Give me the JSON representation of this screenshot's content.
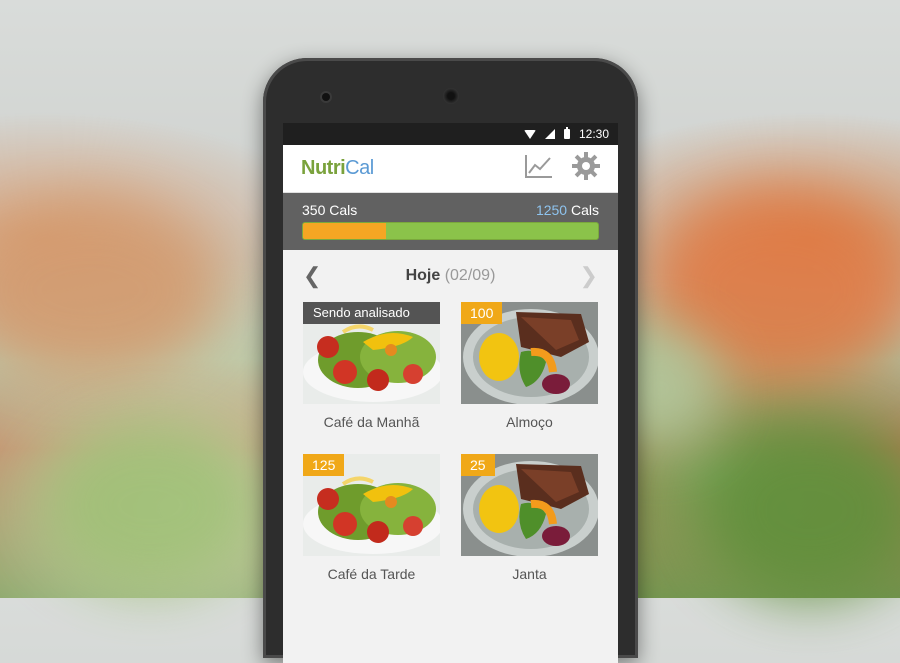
{
  "statusbar": {
    "time": "12:30",
    "icons": [
      "wifi-icon",
      "signal-icon",
      "battery-icon"
    ]
  },
  "app": {
    "logo_part1": "Nutri",
    "logo_part2": "Cal",
    "icons": [
      "chart-icon",
      "gear-icon"
    ]
  },
  "calories": {
    "consumed_value": "350",
    "consumed_unit": "Cals",
    "goal_value": "1250",
    "goal_unit": "Cals",
    "progress_fraction": 0.28
  },
  "day": {
    "label": "Hoje",
    "date": "(02/09)"
  },
  "meals": [
    {
      "name": "Café da Manhã",
      "badge": "Sendo analisado",
      "analyzing": true,
      "image": "salad"
    },
    {
      "name": "Almoço",
      "badge": "100",
      "analyzing": false,
      "image": "steak-plate"
    },
    {
      "name": "Café da Tarde",
      "badge": "125",
      "analyzing": false,
      "image": "salad"
    },
    {
      "name": "Janta",
      "badge": "25",
      "analyzing": false,
      "image": "steak-plate"
    }
  ],
  "colors": {
    "accent_green": "#8bc34a",
    "accent_orange": "#f5a623",
    "logo_blue": "#5b9ad4"
  }
}
